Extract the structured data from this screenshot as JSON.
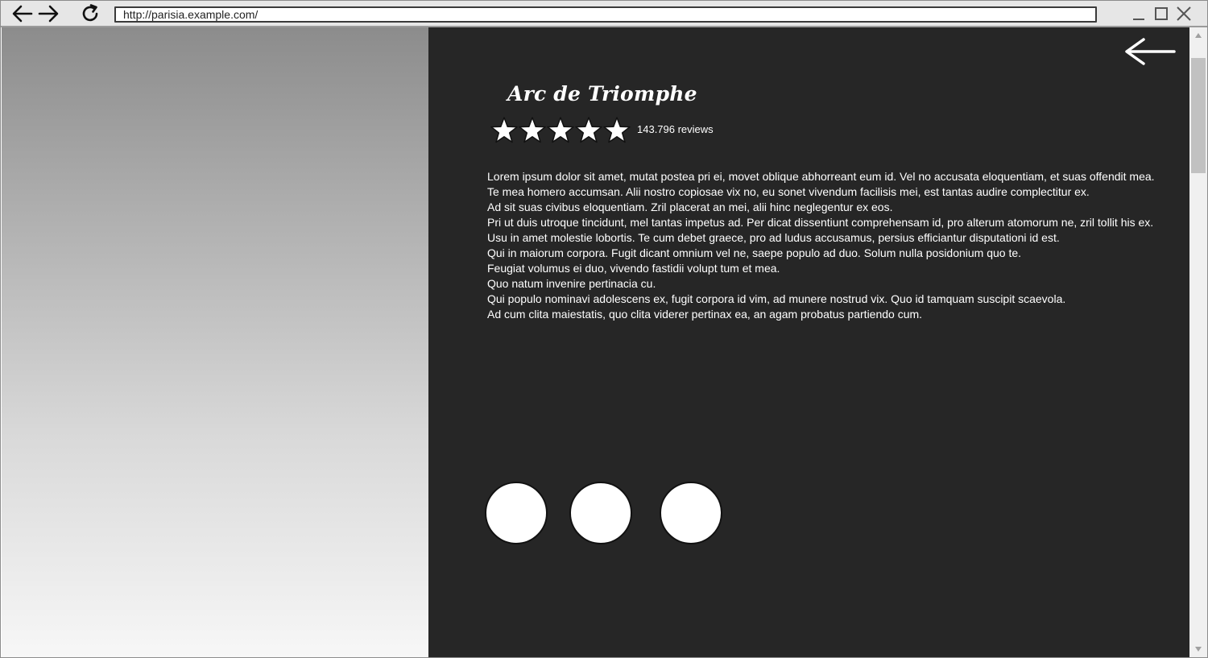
{
  "browser": {
    "url": "http://parisia.example.com/",
    "icons": {
      "back": "arrow-left-icon",
      "forward": "arrow-right-icon",
      "reload": "reload-icon",
      "minimize": "minimize-icon",
      "maximize": "maximize-icon",
      "close": "close-icon"
    }
  },
  "detail": {
    "title": "Arc de Triomphe",
    "rating": {
      "stars_filled": 5,
      "stars_total": 5,
      "reviews_label": "143.796 reviews"
    },
    "description_lines": [
      "Lorem ipsum dolor sit amet, mutat postea pri ei, movet oblique abhorreant eum id. Vel no accusata eloquentiam, et suas offendit mea.",
      "Te mea homero accumsan. Alii nostro copiosae vix no, eu sonet vivendum facilisis mei, est tantas audire complectitur ex.",
      "Ad sit suas civibus eloquentiam. Zril placerat an mei, alii hinc neglegentur ex eos.",
      "Pri ut duis utroque tincidunt, mel tantas impetus ad. Per dicat dissentiunt comprehensam id, pro alterum atomorum ne, zril tollit his ex.",
      "Usu in amet molestie lobortis. Te cum debet graece, pro ad ludus accusamus, persius efficiantur disputationi id est.",
      "Qui in maiorum corpora. Fugit dicant omnium vel ne, saepe populo ad duo. Solum nulla posidonium quo te.",
      "Feugiat volumus ei duo, vivendo fastidii volupt tum et mea.",
      "Quo natum invenire pertinacia cu.",
      "Qui populo nominavi adolescens ex, fugit corpora id vim, ad munere nostrud vix. Quo id tamquam suscipit scaevola.",
      "Ad cum clita maiestatis, quo clita viderer pertinax ea, an agam probatus partiendo cum."
    ],
    "back_icon": "arrow-left-icon",
    "thumbnail_count": 3
  },
  "colors": {
    "panel_bg": "#262626",
    "text": "#ffffff",
    "gradient_top": "#8c8c8c",
    "gradient_bottom": "#f7f7f7"
  }
}
